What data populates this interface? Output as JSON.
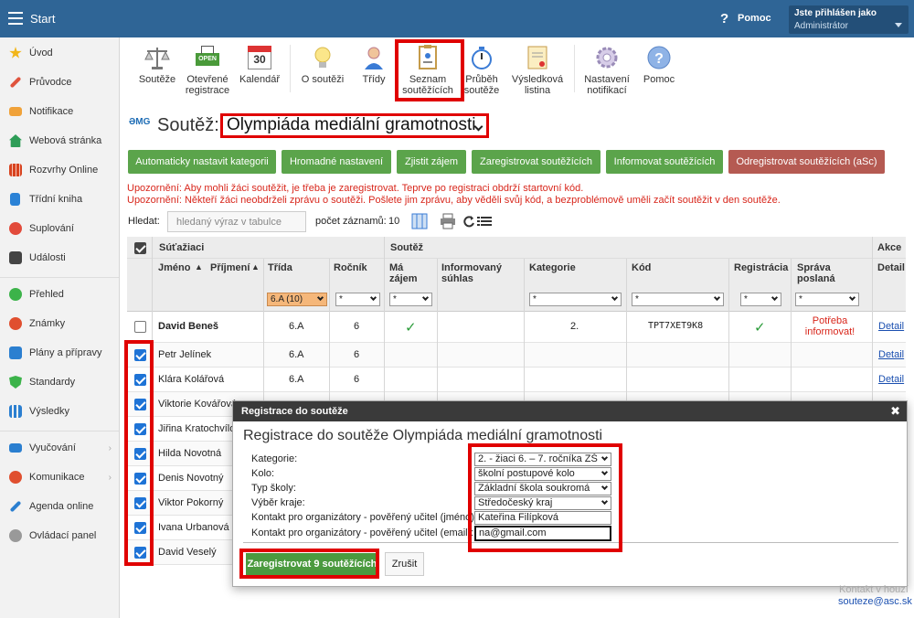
{
  "topbar": {
    "title": "Start",
    "help_label": "Pomoc",
    "user_line1": "Jste přihlášen jako",
    "user_line2": "Administrátor"
  },
  "sidebar": {
    "items": [
      {
        "label": "Úvod",
        "icon": "star-icon",
        "color": "#f2b61a"
      },
      {
        "label": "Průvodce",
        "icon": "wand-icon",
        "color": "#e0543e"
      },
      {
        "label": "Notifikace",
        "icon": "envelope-icon",
        "color": "#f0a23a"
      },
      {
        "label": "Webová stránka",
        "icon": "home-icon",
        "color": "#2e9d57"
      },
      {
        "label": "Rozvrhy Online",
        "icon": "grid-icon",
        "color": "#d8431f"
      },
      {
        "label": "Třídní kniha",
        "icon": "book-icon",
        "color": "#2b82d6"
      },
      {
        "label": "Suplování",
        "icon": "person-icon",
        "color": "#e24b3b"
      },
      {
        "label": "Události",
        "icon": "calendar-icon",
        "color": "#444"
      },
      {
        "label": "Přehled",
        "icon": "check-circle-icon",
        "color": "#3cb34a"
      },
      {
        "label": "Známky",
        "icon": "grade-icon",
        "color": "#e04f2f"
      },
      {
        "label": "Plány a přípravy",
        "icon": "briefcase-icon",
        "color": "#2b7fd0"
      },
      {
        "label": "Standardy",
        "icon": "shield-icon",
        "color": "#3cb34a"
      },
      {
        "label": "Výsledky",
        "icon": "bar-chart-icon",
        "color": "#2b7fd0"
      },
      {
        "label": "Vyučování",
        "icon": "book-open-icon",
        "color": "#2b7fd0"
      },
      {
        "label": "Komunikace",
        "icon": "chat-icon",
        "color": "#e04f2f"
      },
      {
        "label": "Agenda online",
        "icon": "pen-icon",
        "color": "#2b7fd0"
      },
      {
        "label": "Ovládací panel",
        "icon": "gear-icon",
        "color": "#999"
      }
    ]
  },
  "toolbar": {
    "items": [
      {
        "label": "Soutěže",
        "icon": "scales-icon"
      },
      {
        "label": "Otevřené registrace",
        "icon": "open-sign-icon",
        "badge": "OPEN"
      },
      {
        "label": "Kalendář",
        "icon": "calendar-icon",
        "badge": "30"
      },
      {
        "label": "O soutěži",
        "icon": "lightbulb-icon"
      },
      {
        "label": "Třídy",
        "icon": "student-icon"
      },
      {
        "label": "Seznam soutěžících",
        "icon": "clipboard-icon"
      },
      {
        "label": "Průběh soutěže",
        "icon": "stopwatch-icon"
      },
      {
        "label": "Výsledková listina",
        "icon": "certificate-icon"
      },
      {
        "label": "Nastavení notifikací",
        "icon": "gear-icon"
      },
      {
        "label": "Pomoc",
        "icon": "help-icon"
      }
    ]
  },
  "heading": {
    "logo": "ƏMG",
    "label": "Soutěž:",
    "competition": "Olympiáda mediální gramotnosti"
  },
  "actions": [
    "Automaticky nastavit kategorii",
    "Hromadné nastavení",
    "Zjistit zájem",
    "Zaregistrovat soutěžících",
    "Informovat soutěžících",
    "Odregistrovat soutěžících (aSc)"
  ],
  "warnings": [
    "Upozornění: Aby mohli žáci soutěžit, je třeba je zaregistrovat. Teprve po registraci obdrží startovní kód.",
    "Upozornění: Někteří žáci neobdrželi zprávu o soutěži. Pošlete jim zprávu, aby věděli svůj kód, a bezproblémově uměli začít soutěžit v den soutěže."
  ],
  "search": {
    "label": "Hledat:",
    "placeholder": "hledaný výraz v tabulce",
    "count_label": "počet záznamů:",
    "count": "10"
  },
  "table": {
    "group_students": "Súťažiaci",
    "group_competition": "Soutěž",
    "group_actions": "Akce",
    "columns": {
      "first": "Jméno",
      "last": "Příjmení",
      "class": "Třída",
      "year": "Ročník",
      "interest": "Má zájem",
      "consent": "Informovaný súhlas",
      "category": "Kategorie",
      "code": "Kód",
      "registration": "Registrácia",
      "message": "Správa poslaná",
      "detail": "Detail"
    },
    "filters": {
      "class": "6.A (10)",
      "any": "*"
    },
    "rows": [
      {
        "name": "David Beneš",
        "class": "6.A",
        "year": "6",
        "interest": "✓",
        "category": "2.",
        "code": "TPT7XET9K8",
        "registered": "✓",
        "message": "Potřeba informovat!",
        "detail": "Detail",
        "checked": false
      },
      {
        "name": "Petr Jelínek",
        "class": "6.A",
        "year": "6",
        "detail": "Detail",
        "checked": true
      },
      {
        "name": "Klára Kolářová",
        "class": "6.A",
        "year": "6",
        "detail": "Detail",
        "checked": true
      },
      {
        "name": "Viktorie Kovářová",
        "checked": true
      },
      {
        "name": "Jiřina Kratochvílová",
        "checked": true
      },
      {
        "name": "Hilda Novotná",
        "checked": true
      },
      {
        "name": "Denis Novotný",
        "checked": true
      },
      {
        "name": "Viktor Pokorný",
        "checked": true
      },
      {
        "name": "Ivana Urbanová",
        "checked": true
      },
      {
        "name": "David Veselý",
        "checked": true
      }
    ]
  },
  "modal": {
    "header": "Registrace do soutěže",
    "title": "Registrace do soutěže Olympiáda mediální gramotnosti",
    "fields": [
      {
        "label": "Kategorie:",
        "value": "2. - žiaci 6. – 7. ročníka ZŠ",
        "type": "select"
      },
      {
        "label": "Kolo:",
        "value": "školní postupové kolo",
        "type": "select"
      },
      {
        "label": "Typ školy:",
        "value": "Základní škola soukromá",
        "type": "select"
      },
      {
        "label": "Výběr kraje:",
        "value": "Středočeský kraj",
        "type": "select"
      },
      {
        "label": "Kontakt pro organizátory - pověřený učitel (jméno):",
        "value": "Kateřina Filípková",
        "type": "text"
      },
      {
        "label": "Kontakt pro organizátory - pověřený učitel (email):",
        "value": "na@gmail.com",
        "type": "text"
      }
    ],
    "register_button": "Zaregistrovat 9 soutěžících",
    "cancel_button": "Zrušit"
  },
  "footer": {
    "contact_label": "Kontakt v houzí",
    "email": "souteze@asc.sk"
  }
}
